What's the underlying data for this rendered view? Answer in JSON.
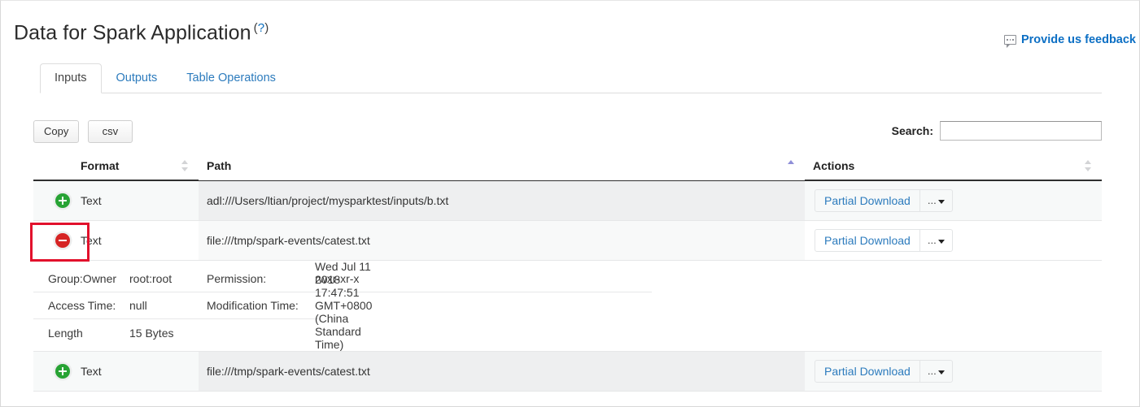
{
  "header": {
    "title": "Data for Spark Application",
    "help_marker": "(?)",
    "feedback_label": "Provide us feedback",
    "feedback_icon": "speech-bubble-icon"
  },
  "tabs": [
    {
      "label": "Inputs",
      "active": true
    },
    {
      "label": "Outputs",
      "active": false
    },
    {
      "label": "Table Operations",
      "active": false
    }
  ],
  "toolbar": {
    "copy_label": "Copy",
    "csv_label": "csv",
    "search_label": "Search:",
    "search_value": "",
    "search_placeholder": ""
  },
  "table": {
    "columns": [
      {
        "key": "expander",
        "label": "",
        "sortable": false,
        "sort": "none"
      },
      {
        "key": "format",
        "label": "Format",
        "sortable": true,
        "sort": "none"
      },
      {
        "key": "path",
        "label": "Path",
        "sortable": true,
        "sort": "asc"
      },
      {
        "key": "actions",
        "label": "Actions",
        "sortable": true,
        "sort": "none"
      }
    ],
    "rows": [
      {
        "expanded": false,
        "expander_icon": "plus-circle-icon",
        "format": "Text",
        "path": "adl:///Users/ltian/project/mysparktest/inputs/b.txt",
        "action_primary": "Partial Download",
        "action_more": "..."
      },
      {
        "expanded": true,
        "expander_icon": "minus-circle-icon",
        "format": "Text",
        "path": "file:///tmp/spark-events/catest.txt",
        "action_primary": "Partial Download",
        "action_more": "...",
        "details": [
          {
            "label1": "Group:Owner",
            "value1": "root:root",
            "label2": "Permission:",
            "value2": "rwxr-xr-x"
          },
          {
            "label1": "Access Time:",
            "value1": "null",
            "label2": "Modification Time:",
            "value2": "Wed Jul 11 2018 17:47:51 GMT+0800 (China Standard Time)"
          },
          {
            "label1": "Length",
            "value1": "15 Bytes",
            "label2": "",
            "value2": ""
          }
        ]
      },
      {
        "expanded": false,
        "expander_icon": "plus-circle-icon",
        "format": "Text",
        "path": "file:///tmp/spark-events/catest.txt",
        "action_primary": "Partial Download",
        "action_more": "..."
      }
    ]
  },
  "annotation": {
    "color": "#e2112c",
    "target": "collapse-expander-row-2"
  }
}
